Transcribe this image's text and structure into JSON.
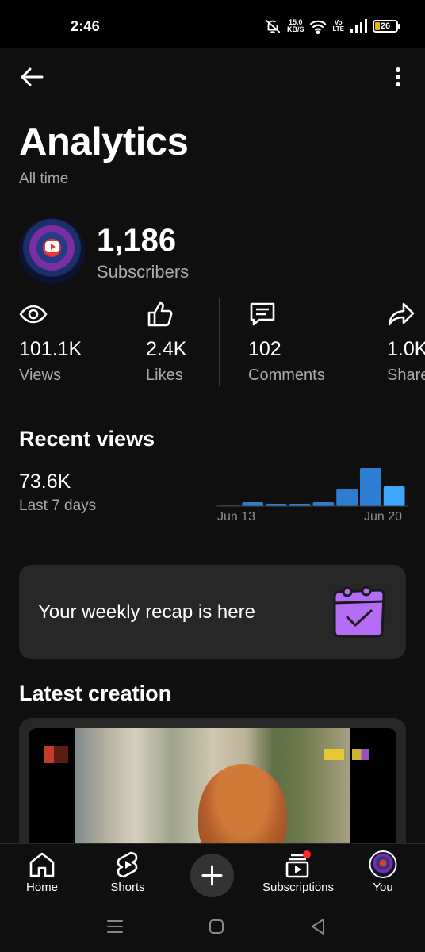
{
  "status_bar": {
    "time": "2:46",
    "net_speed_value": "15.0",
    "net_speed_unit": "KB/S",
    "volte_top": "Vo",
    "volte_bottom": "LTE",
    "battery": "26"
  },
  "header": {
    "title": "Analytics",
    "subtitle": "All time"
  },
  "channel": {
    "subscriber_count": "1,186",
    "subscriber_label": "Subscribers"
  },
  "stats": [
    {
      "value": "101.1K",
      "label": "Views",
      "icon": "eye-icon"
    },
    {
      "value": "2.4K",
      "label": "Likes",
      "icon": "thumbs-up-icon"
    },
    {
      "value": "102",
      "label": "Comments",
      "icon": "comment-icon"
    },
    {
      "value": "1.0K",
      "label": "Shares",
      "icon": "share-icon"
    }
  ],
  "recent_views": {
    "title": "Recent views",
    "value": "73.6K",
    "period": "Last 7 days"
  },
  "chart_data": {
    "type": "bar",
    "x_tick_labels": [
      "Jun 13",
      "Jun 20"
    ],
    "values": [
      1,
      5,
      3,
      3,
      5,
      22,
      48,
      25
    ],
    "bar_color": "#2d7dd2",
    "highlight_color": "#3ea6ff",
    "grid": false
  },
  "recap": {
    "text": "Your weekly recap is here",
    "icon": "calendar-check-icon"
  },
  "latest_creation": {
    "title": "Latest creation"
  },
  "bottom_nav": {
    "home": "Home",
    "shorts": "Shorts",
    "subscriptions": "Subscriptions",
    "you": "You"
  },
  "colors": {
    "background": "#0f0f0f",
    "card": "#272727",
    "text_secondary": "#aaaaaa",
    "accent_blue": "#3ea6ff",
    "notification_red": "#ff2b2b",
    "recap_purple": "#b46cf5"
  }
}
